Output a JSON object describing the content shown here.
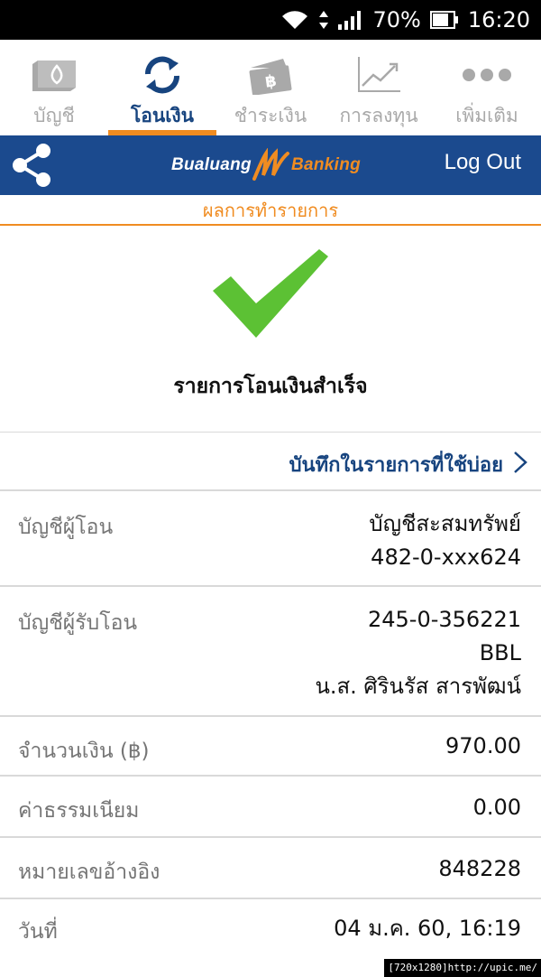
{
  "status_bar": {
    "battery": "70%",
    "time": "16:20",
    "icons": [
      "wifi-icon",
      "data-arrows-icon",
      "signal-icon",
      "battery-icon"
    ]
  },
  "tabs": [
    {
      "label": "บัญชี",
      "icon": "account-book-icon",
      "active": false
    },
    {
      "label": "โอนเงิน",
      "icon": "transfer-arrows-icon",
      "active": true
    },
    {
      "label": "ชำระเงิน",
      "icon": "payment-wallet-icon",
      "active": false
    },
    {
      "label": "การลงทุน",
      "icon": "investment-chart-icon",
      "active": false
    },
    {
      "label": "เพิ่มเติม",
      "icon": "more-dots-icon",
      "active": false
    }
  ],
  "header": {
    "brand_left": "Bualuang",
    "brand_right": "Banking",
    "logout": "Log Out"
  },
  "page_title": "ผลการทำรายการ",
  "success_message": "รายการโอนเงินสำเร็จ",
  "save_favorite": "บันทึกในรายการที่ใช้บ่อย",
  "details": {
    "from_account": {
      "label": "บัญชีผู้โอน",
      "lines": [
        "บัญชีสะสมทรัพย์",
        "482-0-xxx624"
      ]
    },
    "to_account": {
      "label": "บัญชีผู้รับโอน",
      "lines": [
        "245-0-356221",
        "BBL",
        "น.ส. ศิรินรัส สารพัฒน์"
      ]
    },
    "amount": {
      "label": "จำนวนเงิน (฿)",
      "value": "970.00"
    },
    "fee": {
      "label": "ค่าธรรมเนียม",
      "value": "0.00"
    },
    "reference": {
      "label": "หมายเลขอ้างอิง",
      "value": "848228"
    },
    "date": {
      "label": "วันที่",
      "value": "04 ม.ค. 60, 16:19"
    }
  },
  "watermark": "[720x1280]http://upic.me/",
  "colors": {
    "brand_blue": "#1b4a8e",
    "accent_orange": "#f08c21",
    "success_green": "#5cc134",
    "tab_inactive": "#a9a9a9"
  }
}
